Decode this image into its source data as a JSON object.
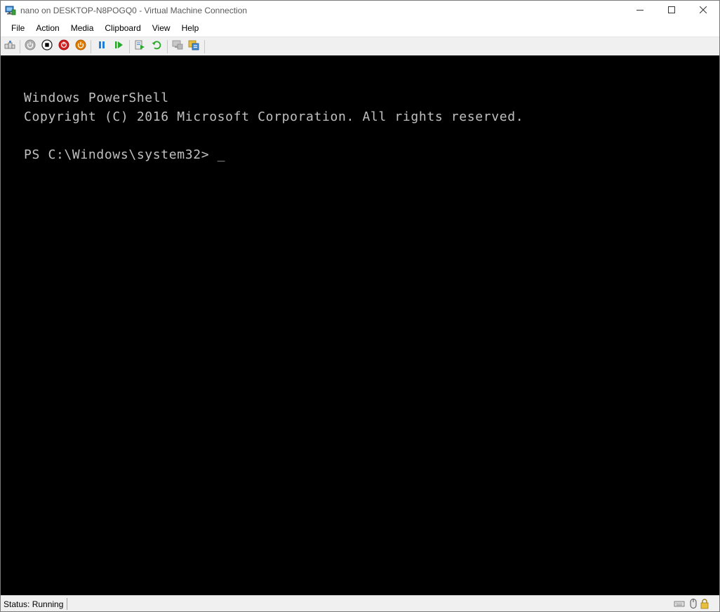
{
  "window": {
    "title": "nano on DESKTOP-N8POGQ0 - Virtual Machine Connection",
    "icon": "vm-connection-icon"
  },
  "title_controls": {
    "minimize_icon": "minimize-icon",
    "maximize_icon": "maximize-icon",
    "close_icon": "close-icon"
  },
  "menu": {
    "items": [
      "File",
      "Action",
      "Media",
      "Clipboard",
      "View",
      "Help"
    ]
  },
  "toolbar": {
    "buttons": [
      {
        "icon": "ctrl-alt-del-icon"
      },
      {
        "icon": "start-icon",
        "color": "#8a8a8a"
      },
      {
        "icon": "turn-off-icon",
        "color": "#000000"
      },
      {
        "icon": "shut-down-icon",
        "color": "#d42020"
      },
      {
        "icon": "save-icon",
        "color": "#e07b00"
      },
      {
        "icon": "pause-icon",
        "color": "#1e7fd8"
      },
      {
        "icon": "resume-icon",
        "color": "#2aa82a"
      },
      {
        "icon": "checkpoint-icon"
      },
      {
        "icon": "revert-icon",
        "color": "#2aa82a"
      },
      {
        "icon": "enhanced-session-icon"
      },
      {
        "icon": "share-icon"
      }
    ]
  },
  "console": {
    "lines": [
      "Windows PowerShell",
      "Copyright (C) 2016 Microsoft Corporation. All rights reserved.",
      "PS C:\\Windows\\system32> _"
    ],
    "background": "#000000",
    "foreground": "#c0c0c0"
  },
  "status": {
    "text": "Status: Running",
    "icons": [
      "keyboard-icon",
      "mouse-icon",
      "lock-icon"
    ]
  }
}
